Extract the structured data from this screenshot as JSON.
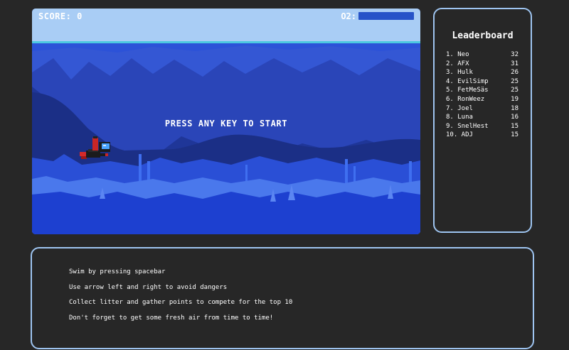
{
  "hud": {
    "score_label": "SCORE: 0",
    "o2_label": "O2:",
    "o2_level": 1.0
  },
  "game": {
    "start_prompt": "PRESS ANY KEY TO START"
  },
  "leaderboard": {
    "title": "Leaderboard",
    "entries": [
      {
        "name": "1. Neo",
        "score": "32"
      },
      {
        "name": "2. AFX",
        "score": "31"
      },
      {
        "name": "3. Hulk",
        "score": "26"
      },
      {
        "name": "4. EvilSimp",
        "score": "25"
      },
      {
        "name": "5. FetMeSäs",
        "score": "25"
      },
      {
        "name": "6. RonWeez",
        "score": "19"
      },
      {
        "name": "7. Joel",
        "score": "18"
      },
      {
        "name": "8. Luna",
        "score": "16"
      },
      {
        "name": "9. SnelHest",
        "score": "15"
      },
      {
        "name": "10. ADJ",
        "score": "15"
      }
    ]
  },
  "instructions": [
    "Swim by pressing spacebar",
    "Use arrow left and right to avoid dangers",
    "Collect litter and gather points to compete for the top 10",
    "Don't forget to get some fresh air from time to time!"
  ],
  "colors": {
    "background": "#272727",
    "sky": "#a9cdf5",
    "water_deep": "#1a3bcf",
    "panel_border": "#9ec4f0"
  }
}
